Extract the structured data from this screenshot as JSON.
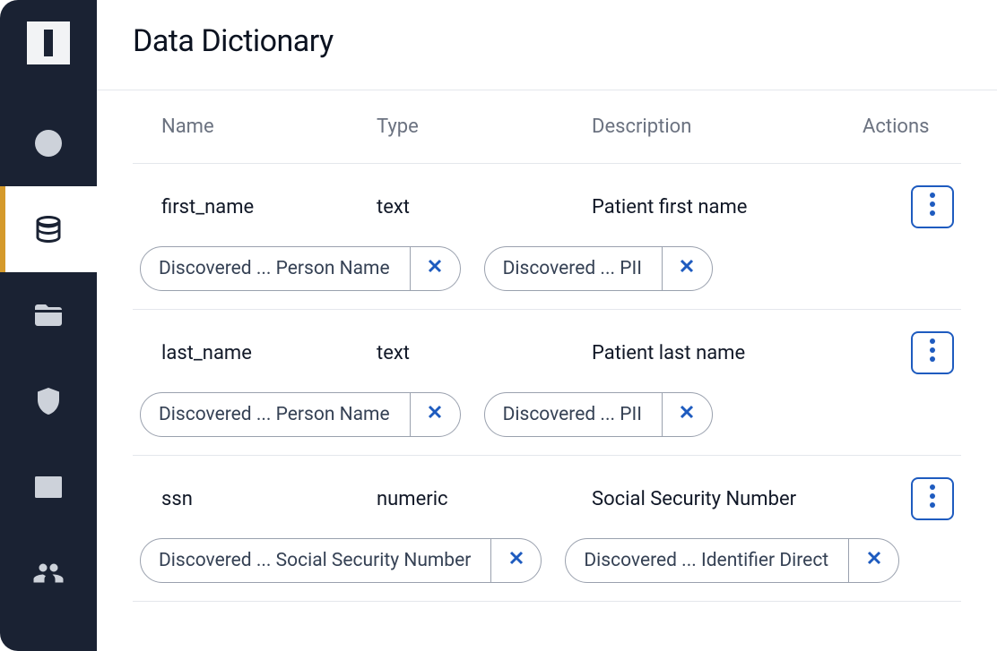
{
  "page": {
    "title": "Data Dictionary"
  },
  "columns": {
    "name": "Name",
    "type": "Type",
    "description": "Description",
    "actions": "Actions"
  },
  "rows": [
    {
      "name": "first_name",
      "type": "text",
      "description": "Patient first name",
      "tags": [
        {
          "label": "Discovered ... Person Name"
        },
        {
          "label": "Discovered ... PII"
        }
      ]
    },
    {
      "name": "last_name",
      "type": "text",
      "description": "Patient last name",
      "tags": [
        {
          "label": "Discovered ... Person Name"
        },
        {
          "label": "Discovered ... PII"
        }
      ]
    },
    {
      "name": "ssn",
      "type": "numeric",
      "description": "Social Security Number",
      "tags": [
        {
          "label": "Discovered ... Social Security Number"
        },
        {
          "label": "Discovered ... Identifier Direct"
        }
      ]
    }
  ],
  "sidebar": {
    "items": [
      {
        "id": "add",
        "icon": "plus-circle-icon",
        "active": false
      },
      {
        "id": "database",
        "icon": "database-icon",
        "active": true
      },
      {
        "id": "folder",
        "icon": "folder-icon",
        "active": false
      },
      {
        "id": "shield",
        "icon": "shield-icon",
        "active": false
      },
      {
        "id": "terminal",
        "icon": "terminal-icon",
        "active": false
      },
      {
        "id": "people",
        "icon": "people-icon",
        "active": false
      }
    ]
  },
  "colors": {
    "sidebar_bg": "#1a2233",
    "accent": "#1e5bbf",
    "active_indicator": "#d59a2b"
  }
}
